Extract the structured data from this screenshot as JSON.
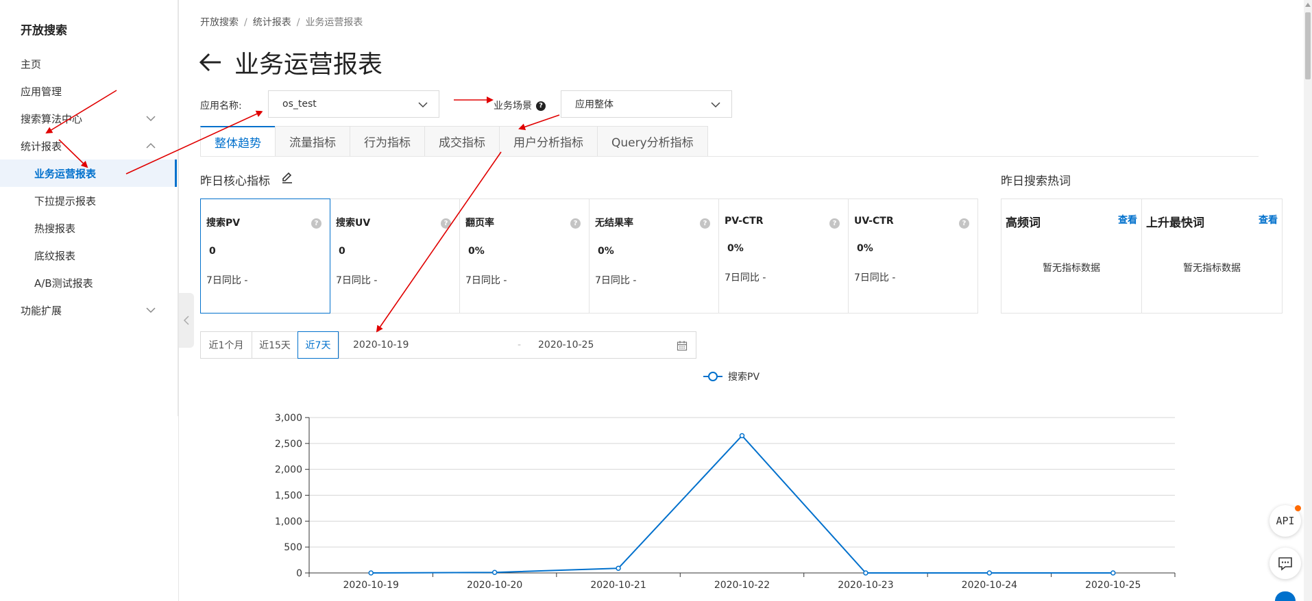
{
  "sidebar": {
    "title": "开放搜索",
    "items": [
      {
        "label": "主页"
      },
      {
        "label": "应用管理"
      },
      {
        "label": "搜索算法中心"
      },
      {
        "label": "统计报表"
      },
      {
        "label": "业务运营报表"
      },
      {
        "label": "下拉提示报表"
      },
      {
        "label": "热搜报表"
      },
      {
        "label": "底纹报表"
      },
      {
        "label": "A/B测试报表"
      },
      {
        "label": "功能扩展"
      }
    ]
  },
  "breadcrumb": {
    "items": [
      "开放搜索",
      "统计报表",
      "业务运营报表"
    ],
    "sep": "/"
  },
  "page": {
    "title": "业务运营报表"
  },
  "filters": {
    "app_label": "应用名称:",
    "app_value": "os_test",
    "scene_label": "业务场景",
    "scene_value": "应用整体"
  },
  "tabs": [
    "整体趋势",
    "流量指标",
    "行为指标",
    "成交指标",
    "用户分析指标",
    "Query分析指标"
  ],
  "core": {
    "title": "昨日核心指标",
    "metrics": [
      {
        "name": "搜索PV",
        "value": "0",
        "cmp": "7日同比 -"
      },
      {
        "name": "搜索UV",
        "value": "0",
        "cmp": "7日同比 -"
      },
      {
        "name": "翻页率",
        "value": "0%",
        "cmp": "7日同比 -"
      },
      {
        "name": "无结果率",
        "value": "0%",
        "cmp": "7日同比 -"
      },
      {
        "name": "PV-CTR",
        "value": "0%",
        "cmp": "7日同比 -"
      },
      {
        "name": "UV-CTR",
        "value": "0%",
        "cmp": "7日同比 -"
      }
    ]
  },
  "hot": {
    "title": "昨日搜索热词",
    "boxes": [
      {
        "name": "高频词",
        "view": "查看",
        "empty": "暂无指标数据"
      },
      {
        "name": "上升最快词",
        "view": "查看",
        "empty": "暂无指标数据"
      }
    ]
  },
  "range": {
    "buttons": [
      "近1个月",
      "近15天",
      "近7天"
    ],
    "start": "2020-10-19",
    "dash": "-",
    "end": "2020-10-25"
  },
  "fab": {
    "api": "API"
  },
  "colors": {
    "accent": "#0070cc",
    "annotation": "#e00000"
  },
  "chart_data": {
    "type": "line",
    "x": [
      "2020-10-19",
      "2020-10-20",
      "2020-10-21",
      "2020-10-22",
      "2020-10-23",
      "2020-10-24",
      "2020-10-25"
    ],
    "series": [
      {
        "name": "搜索PV",
        "values": [
          0,
          10,
          90,
          2650,
          0,
          0,
          0
        ]
      }
    ],
    "ylim": [
      0,
      3000
    ],
    "yticks": [
      "0",
      "500",
      "1,000",
      "1,500",
      "2,000",
      "2,500",
      "3,000"
    ],
    "grid": true,
    "legend": "top-center"
  }
}
